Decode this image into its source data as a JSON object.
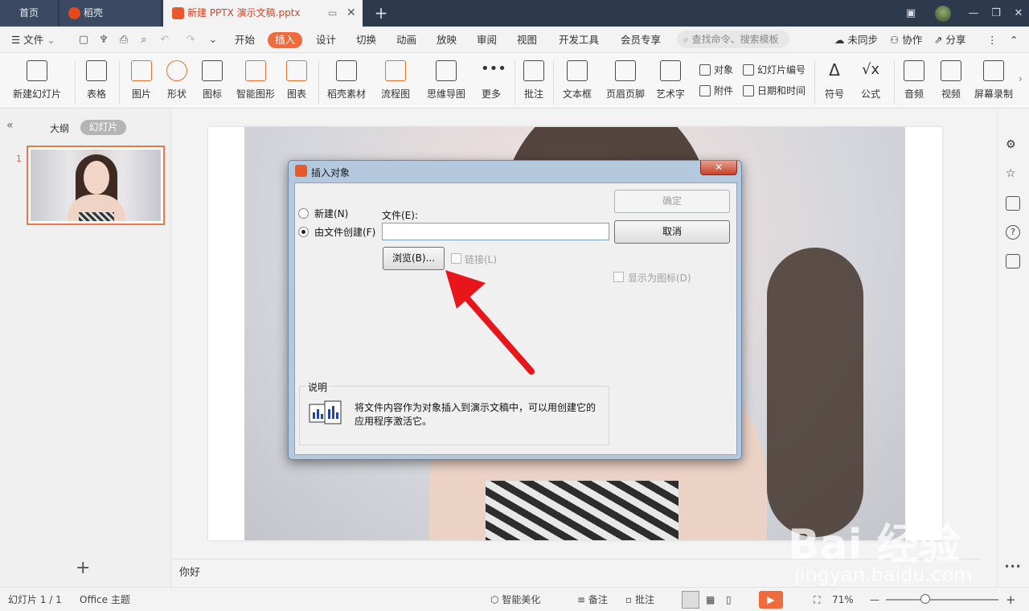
{
  "tabs": {
    "home": "首页",
    "daoke": "稻壳",
    "document": "新建 PPTX 演示文稿.pptx"
  },
  "menu": {
    "file": "文件",
    "items": [
      "开始",
      "插入",
      "设计",
      "切换",
      "动画",
      "放映",
      "审阅",
      "视图",
      "开发工具",
      "会员专享"
    ],
    "active": "插入",
    "search_placeholder": "查找命令、搜索模板",
    "sync": "未同步",
    "collab": "协作",
    "share": "分享"
  },
  "ribbon": {
    "new_slide": "新建幻灯片",
    "table": "表格",
    "picture": "图片",
    "shape": "形状",
    "icon": "图标",
    "smart_shape": "智能图形",
    "chart": "图表",
    "daoke_assets": "稻壳素材",
    "flowchart": "流程图",
    "mindmap": "思维导图",
    "more": "更多",
    "comment": "批注",
    "textbox": "文本框",
    "header_footer": "页眉页脚",
    "wordart": "艺术字",
    "object": "对象",
    "attachment": "附件",
    "slide_number": "幻灯片编号",
    "date_time": "日期和时间",
    "symbol": "符号",
    "formula": "公式",
    "audio": "音频",
    "video": "视频",
    "screen_record": "屏幕录制"
  },
  "left_panel": {
    "outline": "大纲",
    "slides": "幻灯片",
    "slide_number": "1"
  },
  "notes": {
    "text": "你好"
  },
  "dialog": {
    "title": "插入对象",
    "create_new": "新建(N)",
    "create_from_file": "由文件创建(F)",
    "file_label": "文件(E):",
    "file_value": "",
    "browse": "浏览(B)...",
    "link": "链接(L)",
    "ok": "确定",
    "cancel": "取消",
    "display_as_icon": "显示为图标(D)",
    "description_title": "说明",
    "description_line1": "将文件内容作为对象插入到演示文稿中，可以用创建它的",
    "description_line2": "应用程序激活它。",
    "selected_option": "create_from_file"
  },
  "status": {
    "slide_pos": "幻灯片 1 / 1",
    "theme": "Office 主题",
    "beautify": "智能美化",
    "notes": "备注",
    "comments": "批注",
    "zoom": "71%"
  },
  "watermark": {
    "brand": "Bai 经验",
    "url": "jingyan.baidu.com"
  },
  "colors": {
    "accent": "#f06b3b",
    "tabbar": "#2d3a4e",
    "arrow": "#e8161b"
  }
}
